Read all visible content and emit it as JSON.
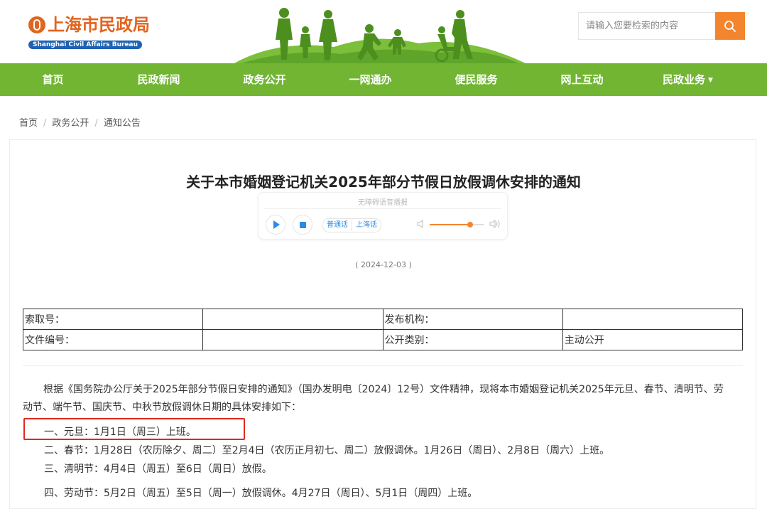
{
  "site": {
    "logo_cn": "上海市民政局",
    "logo_en": "Shanghai Civil Affairs Bureau",
    "brand_color": "#e1641f",
    "nav_color": "#71b533",
    "accent_color": "#f2852e"
  },
  "search": {
    "placeholder": "请输入您要检索的内容",
    "icon": "search-icon"
  },
  "nav": {
    "items": [
      {
        "label": "首页"
      },
      {
        "label": "民政新闻"
      },
      {
        "label": "政务公开"
      },
      {
        "label": "一网通办"
      },
      {
        "label": "便民服务"
      },
      {
        "label": "网上互动"
      },
      {
        "label": "民政业务"
      }
    ]
  },
  "breadcrumb": {
    "items": [
      "首页",
      "政务公开",
      "通知公告"
    ],
    "separator": "/"
  },
  "article": {
    "title": "关于本市婚姻登记机关2025年部分节假日放假调休安排的通知",
    "date": "( 2024-12-03 )"
  },
  "player": {
    "label": "无障碍语音播报",
    "lang_on": "普通话",
    "lang_off": "上海话",
    "volume": 0.75
  },
  "meta_table": {
    "rows": [
      [
        "索取号：",
        "",
        "发布机构：",
        ""
      ],
      [
        "文件编号：",
        "",
        "公开类别：",
        "主动公开"
      ]
    ]
  },
  "content": {
    "intro": "根据《国务院办公厅关于2025年部分节假日安排的通知》（国办发明电〔2024〕12号）文件精神，现将本市婚姻登记机关2025年元旦、春节、清明节、劳动节、端午节、国庆节、中秋节放假调休日期的具体安排如下：",
    "items": [
      "一、元旦：1月1日（周三）上班。",
      "二、春节：1月28日（农历除夕、周二）至2月4日（农历正月初七、周二）放假调休。1月26日（周日）、2月8日（周六）上班。",
      "三、清明节：4月4日（周五）至6日（周日）放假。",
      "四、劳动节：5月2日（周五）至5日（周一）放假调休。4月27日（周日）、5月1日（周四）上班。"
    ]
  }
}
